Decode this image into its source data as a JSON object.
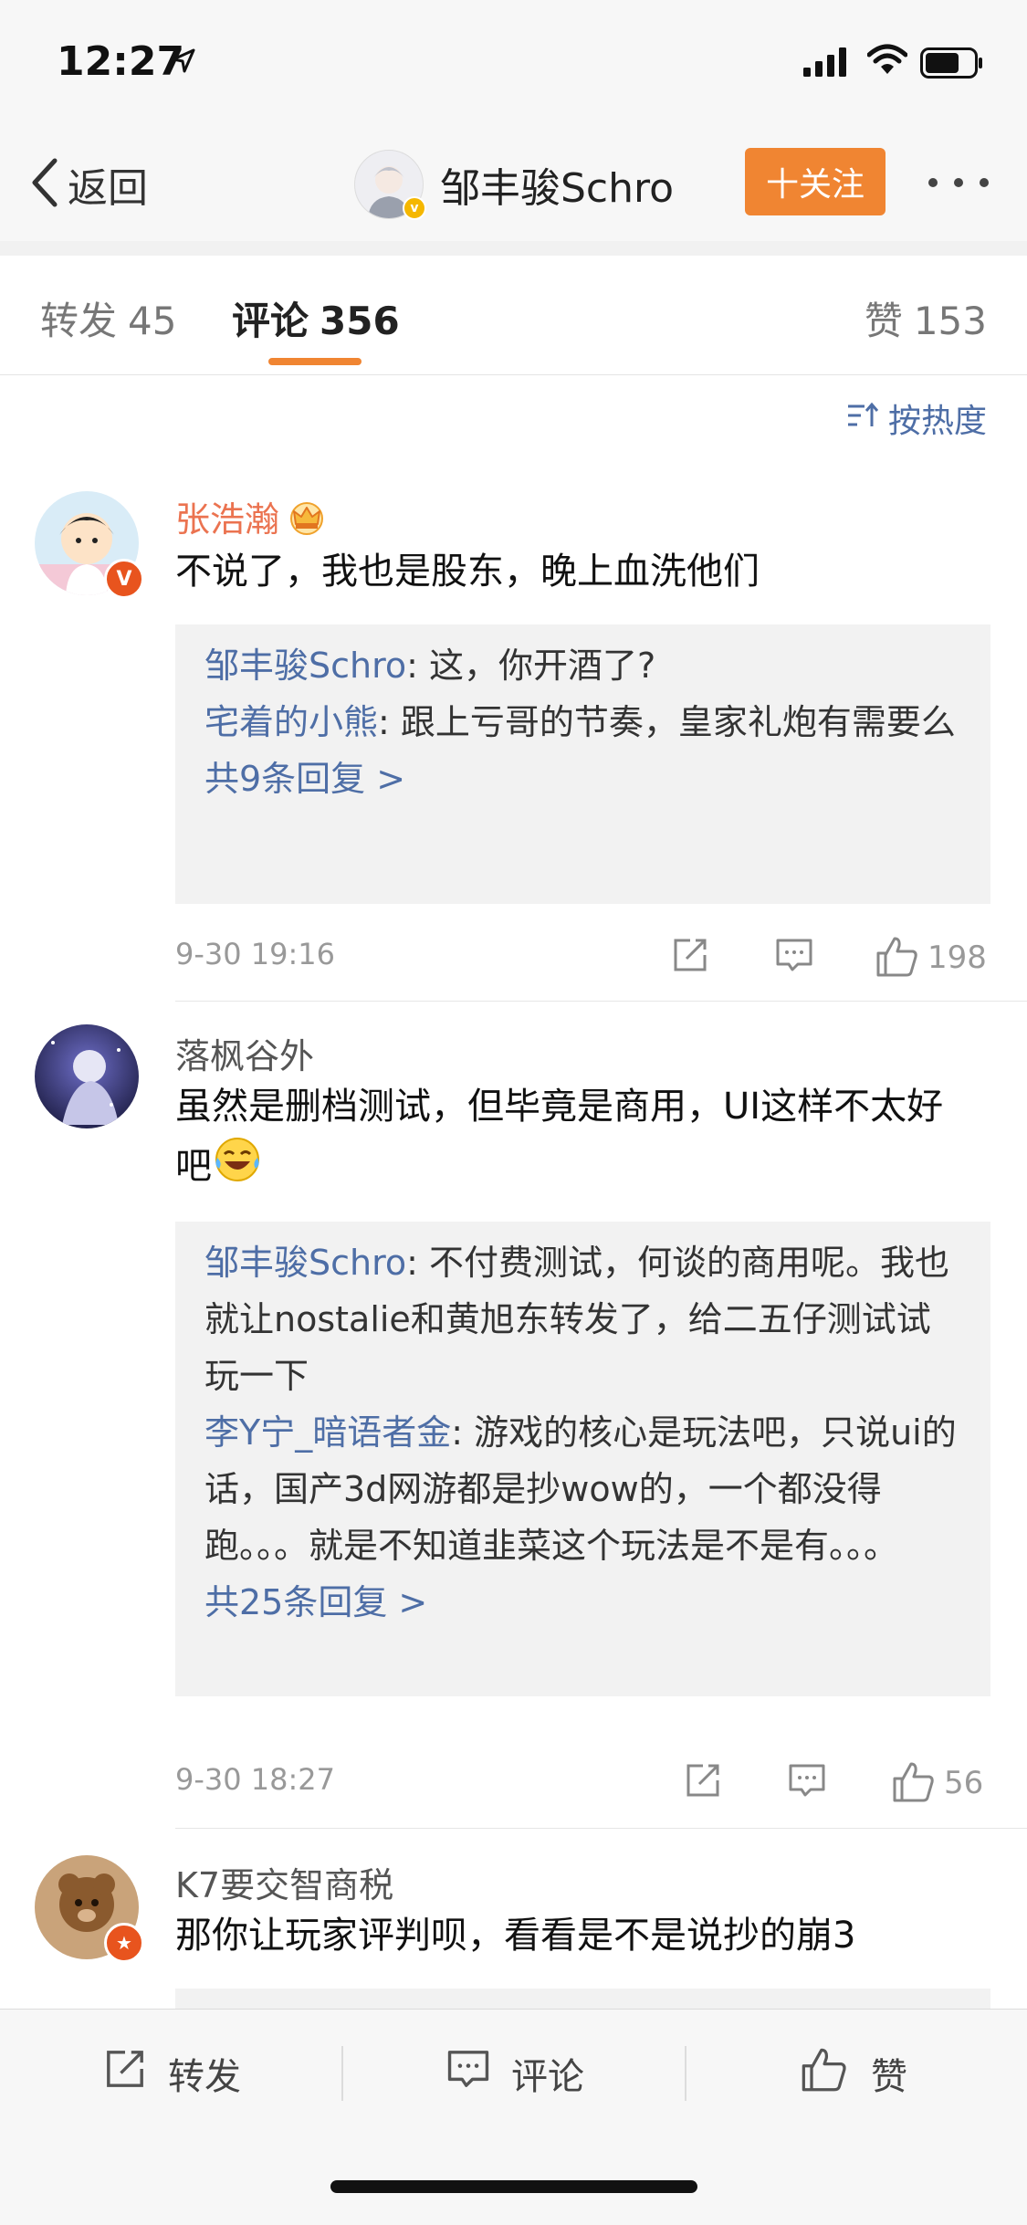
{
  "status_bar": {
    "time": "12:27"
  },
  "nav": {
    "back_label": "返回",
    "title": "邹丰骏Schro",
    "follow_label": "十关注"
  },
  "tabs": {
    "repost_label": "转发",
    "repost_count": "45",
    "comments_label": "评论",
    "comments_count": "356",
    "likes_label": "赞",
    "likes_count": "153"
  },
  "sort_label": "按热度",
  "comments": [
    {
      "username": "张浩瀚",
      "content": "不说了，我也是股东，晚上血洗他们",
      "replies": [
        {
          "name": "邹丰骏Schro",
          "text": ": 这，你开酒了?"
        },
        {
          "name": "宅着的小熊",
          "text": ": 跟上亏哥的节奏，皇家礼炮有需要么"
        }
      ],
      "more_replies": "共9条回复 >",
      "date": "9-30 19:16",
      "likes": "198"
    },
    {
      "username": "落枫谷外",
      "content": "虽然是删档测试，但毕竟是商用，UI这样不太好吧",
      "replies": [
        {
          "name": "邹丰骏Schro",
          "text": ": 不付费测试，何谈的商用呢。我也就让nostalie和黄旭东转发了，给二五仔测试试玩一下"
        },
        {
          "name": "李Y宁_暗语者金",
          "text": ": 游戏的核心是玩法吧，只说ui的话，国产3d网游都是抄wow的，一个都没得跑。。。就是不知道韭菜这个玩法是不是有。。。"
        }
      ],
      "more_replies": "共25条回复 >",
      "date": "9-30 18:27",
      "likes": "56"
    },
    {
      "username": "K7要交智商税",
      "content": "那你让玩家评判呗，看看是不是说抄的崩3"
    }
  ],
  "bottom_bar": {
    "repost_label": "转发",
    "comment_label": "评论",
    "like_label": "赞"
  },
  "colors": {
    "accent": "#f08532",
    "link": "#4e6ea6",
    "vip_name": "#eb7350"
  }
}
